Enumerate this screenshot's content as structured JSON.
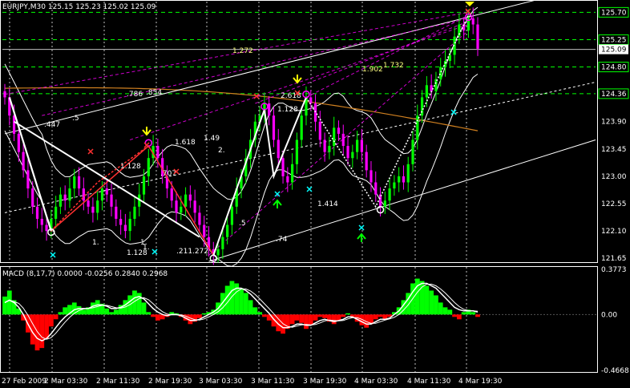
{
  "header": {
    "symbol_line": "EURJPY,M30  125.15 125.23 125.02 125.09",
    "macd_line": "MACD (8,17,7) 0.0000 -0.0256 0.2840 0.2968"
  },
  "colors": {
    "background": "#000000",
    "frame": "#ffffff",
    "bull_candle": "#00ff00",
    "bear_candle": "#ff00ff",
    "macd_pos": "#00ff00",
    "macd_neg": "#ff0000",
    "fib_dash": "#ff00ff",
    "level_green": "#00ff00",
    "zigzag_red": "#ff3030",
    "zigzag_white": "#ffffff",
    "ma_orange": "#d08020",
    "fib_text": "#ffff80",
    "pattern_text": "#00ffff"
  },
  "chart_data": [
    {
      "type": "line",
      "title": "EURJPY,M30  125.15 125.23 125.02 125.09",
      "y_ticks": [
        "125.70",
        "125.25",
        "124.80",
        "124.36",
        "123.90",
        "123.45",
        "123.00",
        "122.55",
        "122.10",
        "121.65"
      ],
      "ylim": [
        121.6,
        125.85
      ],
      "current_price": "125.09",
      "x_ticks": [
        "27 Feb 2009",
        "2 Mar 03:30",
        "2 Mar 11:30",
        "2 Mar 19:30",
        "3 Mar 03:30",
        "3 Mar 11:30",
        "3 Mar 19:30",
        "4 Mar 03:30",
        "4 Mar 11:30",
        "4 Mar 19:30"
      ],
      "highlighted_levels": [
        {
          "label": "125.70",
          "value": 125.7
        },
        {
          "label": "125.25",
          "value": 125.25
        },
        {
          "label": "124.80",
          "value": 124.8
        },
        {
          "label": "124.36",
          "value": 124.36
        }
      ],
      "series": [
        {
          "kind": "close-approx",
          "values": [
            124.3,
            124.0,
            123.7,
            123.4,
            123.1,
            122.8,
            122.5,
            122.3,
            122.2,
            122.1,
            122.3,
            122.5,
            122.7,
            122.6,
            122.8,
            123.0,
            122.8,
            122.6,
            122.5,
            122.4,
            122.6,
            122.8,
            122.7,
            122.5,
            122.3,
            122.2,
            122.1,
            122.3,
            122.5,
            122.7,
            123.0,
            123.3,
            123.5,
            123.3,
            123.0,
            122.8,
            122.6,
            122.4,
            122.5,
            122.7,
            122.6,
            122.4,
            122.2,
            122.0,
            121.8,
            121.7,
            121.8,
            122.0,
            122.2,
            122.5,
            122.8,
            123.0,
            123.3,
            123.6,
            123.9,
            124.0,
            124.2,
            124.0,
            123.6,
            123.3,
            123.0,
            122.9,
            123.2,
            123.6,
            124.0,
            124.3,
            124.2,
            123.9,
            123.6,
            123.4,
            123.5,
            123.8,
            123.7,
            123.5,
            123.3,
            123.4,
            123.6,
            123.4,
            123.1,
            122.9,
            122.7,
            122.5,
            122.6,
            122.8,
            122.9,
            123.0,
            122.9,
            123.2,
            123.6,
            124.0,
            124.3,
            124.5,
            124.4,
            124.6,
            124.8,
            124.9,
            125.0,
            125.3,
            125.5,
            125.4,
            125.6,
            125.5,
            125.1
          ]
        }
      ],
      "fib_labels": [
        "1.272",
        "1.902",
        "1.732",
        ".786",
        ".854",
        "2.618",
        "1.128",
        ".5",
        ".447",
        "1.618",
        "1.49",
        "2.",
        "1.128",
        ".707",
        "1.414",
        ".5",
        ".74",
        "1.",
        "1.",
        "1.",
        "1.128",
        ".211.272"
      ]
    },
    {
      "type": "bar",
      "title": "MACD (8,17,7) 0.0000 -0.0256 0.2840 0.2968",
      "y_ticks": [
        "0.3773",
        "0.00",
        "-0.4668"
      ],
      "ylim": [
        -0.4668,
        0.3773
      ],
      "histogram": [
        0.15,
        0.2,
        0.12,
        0.05,
        -0.05,
        -0.15,
        -0.25,
        -0.3,
        -0.28,
        -0.2,
        -0.1,
        -0.04,
        0.02,
        0.06,
        0.08,
        0.1,
        0.07,
        0.04,
        0.06,
        0.1,
        0.12,
        0.09,
        0.05,
        0.02,
        0.04,
        0.08,
        0.12,
        0.16,
        0.2,
        0.18,
        0.1,
        0.02,
        -0.02,
        -0.05,
        -0.04,
        -0.02,
        0.02,
        0.01,
        -0.02,
        -0.05,
        -0.08,
        -0.06,
        -0.03,
        0.01,
        0.02,
        0.04,
        0.1,
        0.18,
        0.24,
        0.28,
        0.26,
        0.22,
        0.18,
        0.12,
        0.06,
        0.02,
        -0.02,
        -0.05,
        -0.1,
        -0.14,
        -0.16,
        -0.12,
        -0.08,
        -0.05,
        -0.07,
        -0.12,
        -0.09,
        -0.05,
        -0.02,
        -0.03,
        -0.06,
        -0.08,
        -0.05,
        -0.02,
        0.01,
        -0.02,
        -0.06,
        -0.09,
        -0.11,
        -0.08,
        -0.04,
        -0.02,
        -0.04,
        -0.02,
        0.02,
        0.06,
        0.12,
        0.18,
        0.26,
        0.3,
        0.28,
        0.24,
        0.2,
        0.16,
        0.1,
        0.06,
        0.04,
        -0.02,
        -0.04,
        0.02,
        0.04,
        0.02,
        -0.02
      ],
      "signal": [
        0.1,
        0.12,
        0.1,
        0.06,
        0.0,
        -0.08,
        -0.15,
        -0.2,
        -0.22,
        -0.2,
        -0.16,
        -0.11,
        -0.06,
        -0.02,
        0.01,
        0.04,
        0.05,
        0.05,
        0.05,
        0.07,
        0.08,
        0.08,
        0.07,
        0.05,
        0.05,
        0.06,
        0.08,
        0.11,
        0.14,
        0.15,
        0.13,
        0.09,
        0.05,
        0.02,
        0.0,
        -0.01,
        0.0,
        0.0,
        -0.01,
        -0.03,
        -0.05,
        -0.05,
        -0.04,
        -0.02,
        0.0,
        0.02,
        0.05,
        0.1,
        0.15,
        0.2,
        0.22,
        0.22,
        0.2,
        0.17,
        0.13,
        0.09,
        0.05,
        0.01,
        -0.04,
        -0.08,
        -0.11,
        -0.11,
        -0.1,
        -0.08,
        -0.08,
        -0.09,
        -0.09,
        -0.07,
        -0.05,
        -0.04,
        -0.05,
        -0.06,
        -0.05,
        -0.04,
        -0.02,
        -0.02,
        -0.04,
        -0.06,
        -0.08,
        -0.08,
        -0.06,
        -0.04,
        -0.04,
        -0.03,
        0.0,
        0.03,
        0.08,
        0.13,
        0.19,
        0.24,
        0.26,
        0.26,
        0.24,
        0.22,
        0.18,
        0.14,
        0.1,
        0.06,
        0.04,
        0.03,
        0.03,
        0.03,
        0.02
      ]
    }
  ]
}
